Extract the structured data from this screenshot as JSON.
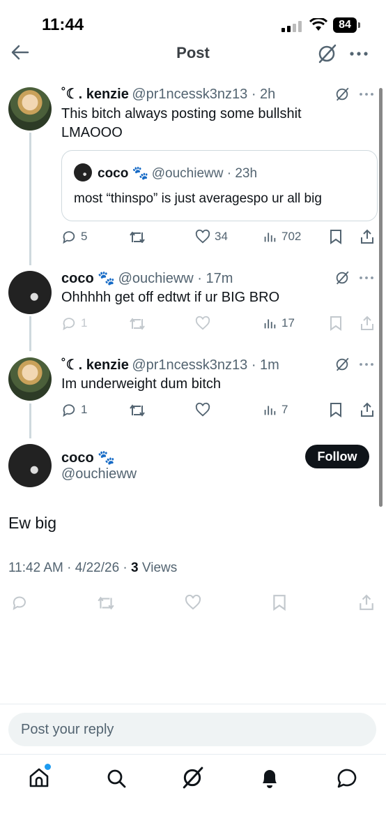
{
  "status": {
    "time": "11:44",
    "battery": "84"
  },
  "header": {
    "title": "Post"
  },
  "posts": [
    {
      "name": "˚☾. kenzie",
      "handle": "@pr1ncessk3nz13 · 2h",
      "text1": "This bitch always posting some bullshit",
      "text2": "LMAOOO",
      "quote": {
        "name": "coco 🐾",
        "handle": "@ouchieww · 23h",
        "text": "most “thinspo” is just averagespo ur all big"
      },
      "replies": "5",
      "likes": "34",
      "views": "702"
    },
    {
      "name": "coco 🐾",
      "handle": "@ouchieww · 17m",
      "text": "Ohhhhh get off edtwt if ur BIG BRO",
      "replies": "1",
      "views": "17"
    },
    {
      "name": "˚☾. kenzie",
      "handle": "@pr1ncessk3nz13 · 1m",
      "text": "Im underweight dum bitch",
      "replies": "1",
      "views": "7"
    }
  ],
  "main": {
    "name": "coco 🐾",
    "handle": "@ouchieww",
    "follow_label": "Follow",
    "text": "Ew big",
    "meta_time": "11:42 AM · 4/22/26 · ",
    "views_count": "3",
    "views_label": " Views"
  },
  "reply": {
    "placeholder": "Post your reply"
  },
  "colors": {
    "accent": "#1d9bf0",
    "text": "#0f1419",
    "muted": "#536471"
  }
}
